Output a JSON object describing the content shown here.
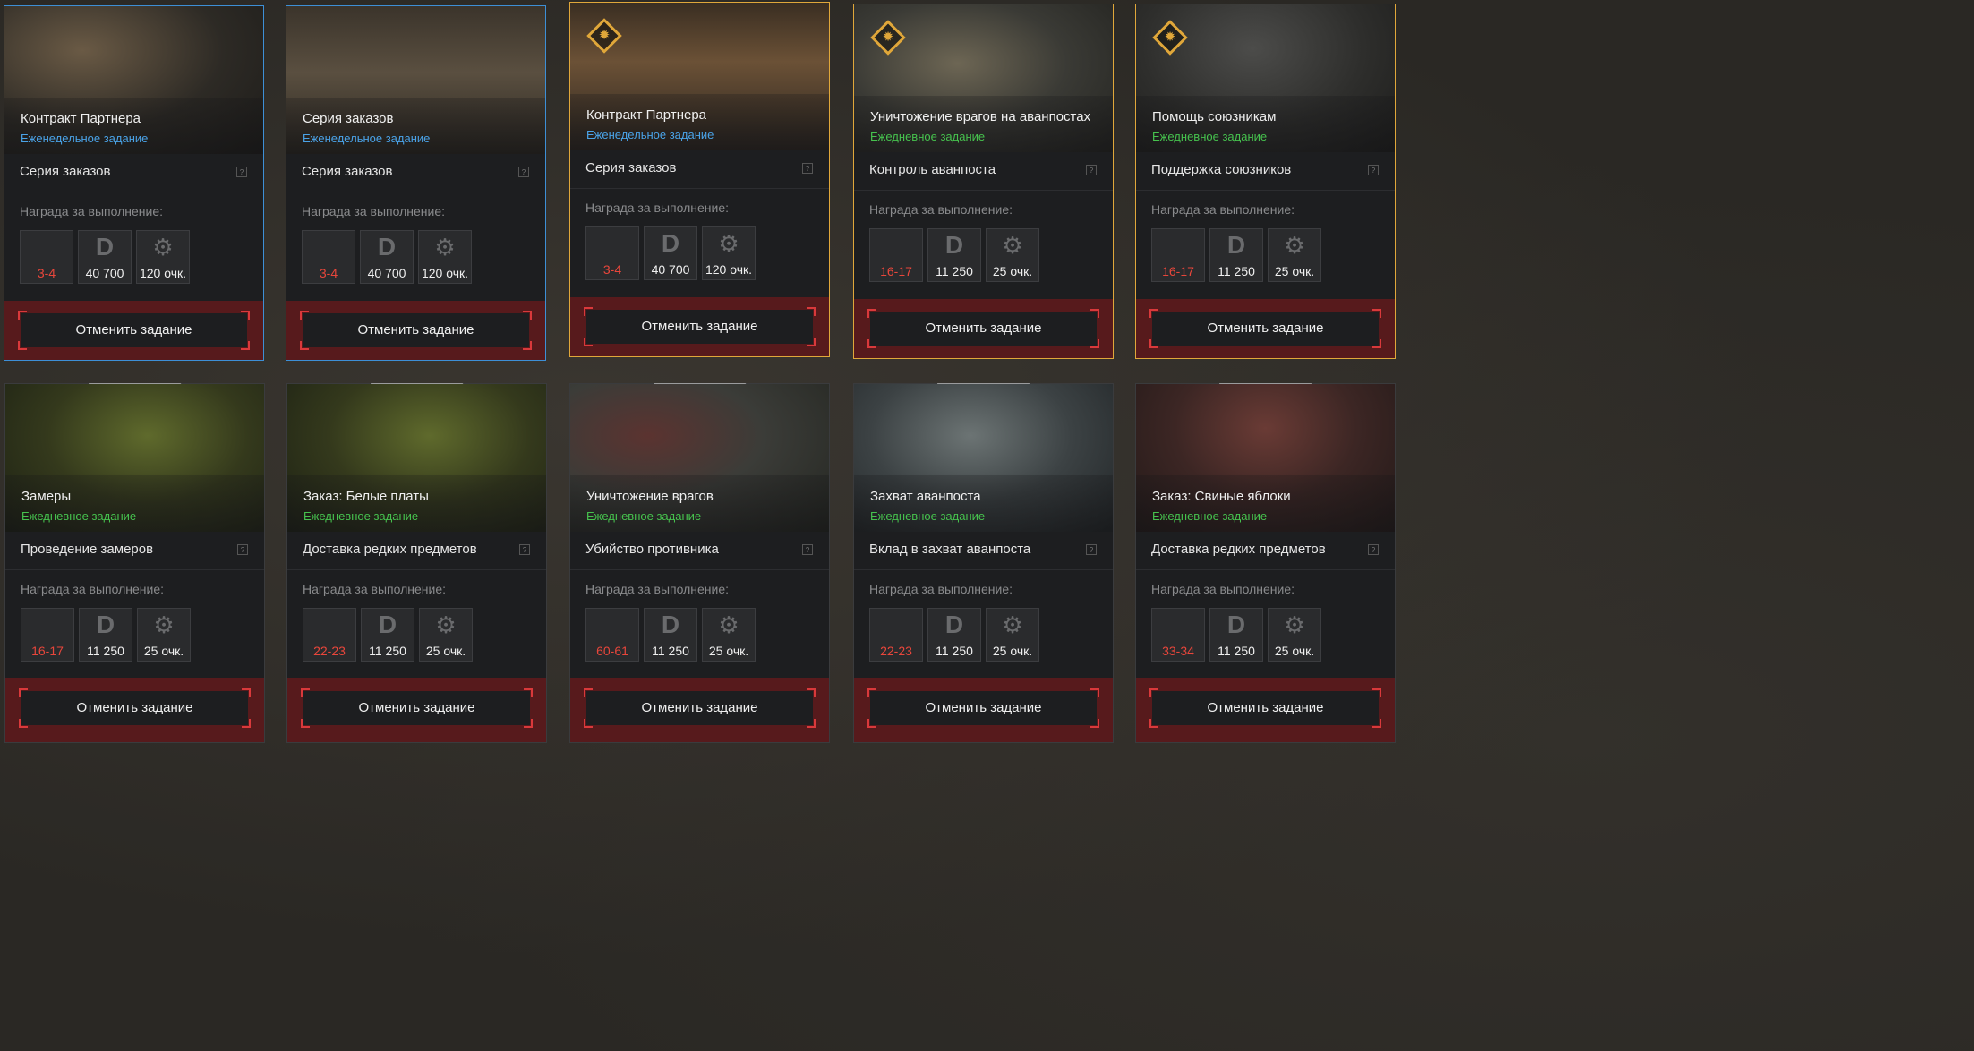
{
  "reward_label": "Награда за выполнение:",
  "cancel_label": "Отменить задание",
  "help_symbol": "?",
  "colors": {
    "weekly": "#4aa3e8",
    "daily": "#46c24e",
    "gold": "#e0a73a",
    "blue": "#3d8fd6",
    "red": "#e8463b"
  },
  "cards": [
    {
      "title": "Контракт Партнера",
      "type": "Еженедельное задание",
      "task": "Серия заказов",
      "rewards": {
        "item": "3-4",
        "money": "40 700",
        "points": "120 очк."
      }
    },
    {
      "title": "Серия заказов",
      "type": "Еженедельное задание",
      "task": "Серия заказов",
      "rewards": {
        "item": "3-4",
        "money": "40 700",
        "points": "120 очк."
      }
    },
    {
      "title": "Контракт Партнера",
      "type": "Еженедельное задание",
      "task": "Серия заказов",
      "rewards": {
        "item": "3-4",
        "money": "40 700",
        "points": "120 очк."
      }
    },
    {
      "title": "Уничтожение врагов на аванпостах",
      "type": "Ежедневное задание",
      "task": "Контроль аванпоста",
      "rewards": {
        "item": "16-17",
        "money": "11 250",
        "points": "25 очк."
      }
    },
    {
      "title": "Помощь союзникам",
      "type": "Ежедневное задание",
      "task": "Поддержка союзников",
      "rewards": {
        "item": "16-17",
        "money": "11 250",
        "points": "25 очк."
      }
    },
    {
      "title": "Замеры",
      "type": "Ежедневное задание",
      "task": "Проведение замеров",
      "rewards": {
        "item": "16-17",
        "money": "11 250",
        "points": "25 очк."
      }
    },
    {
      "title": "Заказ: Белые платы",
      "type": "Ежедневное задание",
      "task": "Доставка редких предметов",
      "rewards": {
        "item": "22-23",
        "money": "11 250",
        "points": "25 очк."
      }
    },
    {
      "title": "Уничтожение врагов",
      "type": "Ежедневное задание",
      "task": "Убийство противника",
      "rewards": {
        "item": "60-61",
        "money": "11 250",
        "points": "25 очк."
      }
    },
    {
      "title": "Захват аванпоста",
      "type": "Ежедневное задание",
      "task": "Вклад в захват аванпоста",
      "rewards": {
        "item": "22-23",
        "money": "11 250",
        "points": "25 очк."
      }
    },
    {
      "title": "Заказ: Свиные яблоки",
      "type": "Ежедневное задание",
      "task": "Доставка редких предметов",
      "rewards": {
        "item": "33-34",
        "money": "11 250",
        "points": "25 очк."
      }
    }
  ]
}
